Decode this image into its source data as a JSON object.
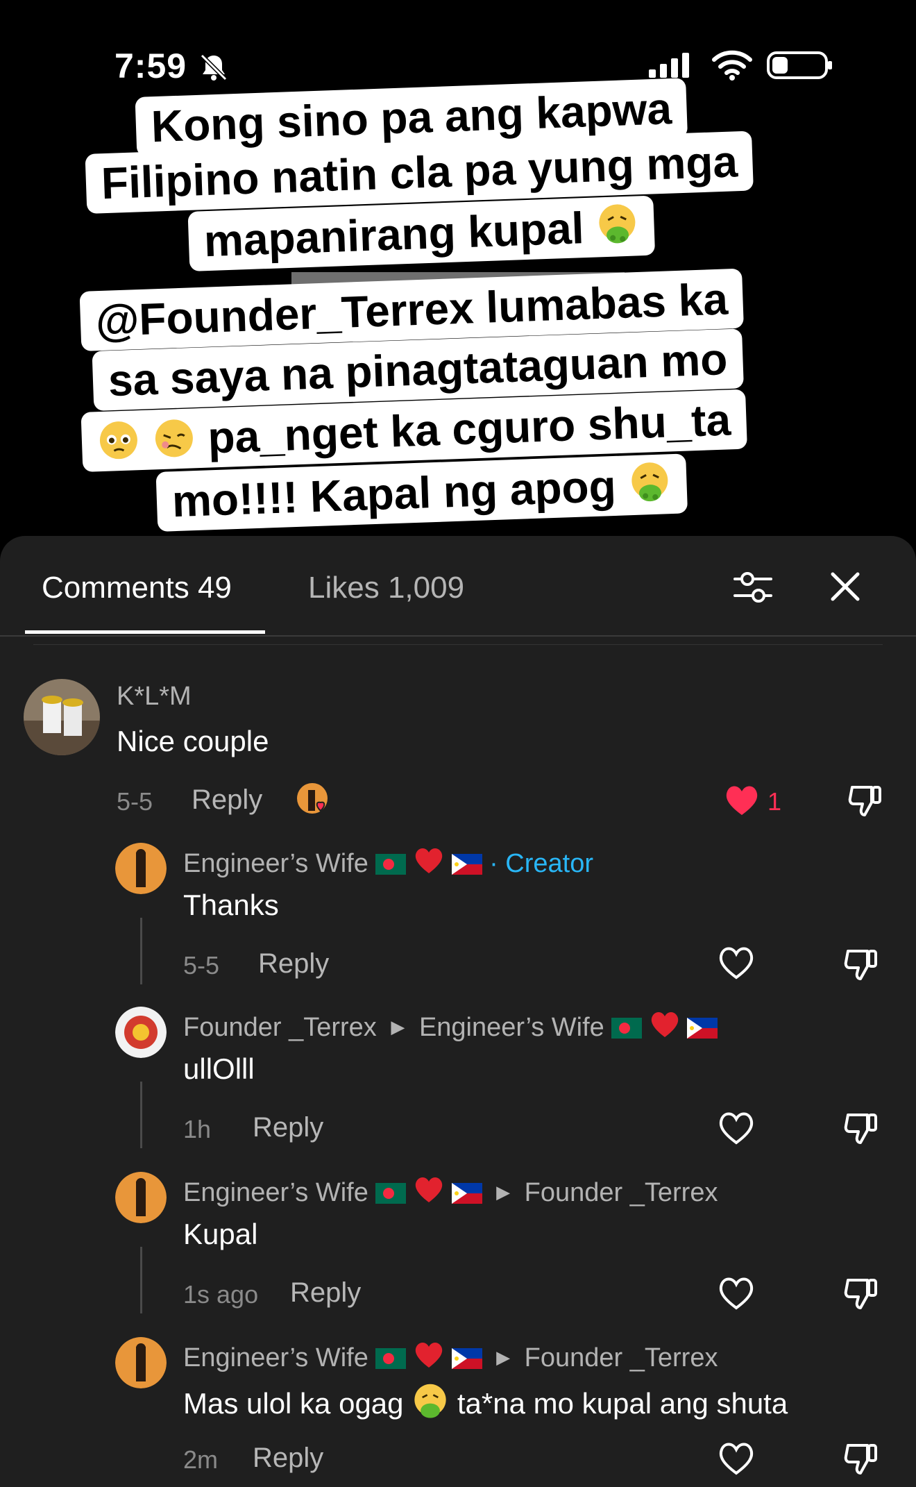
{
  "status_bar": {
    "time": "7:59"
  },
  "overlay": {
    "line1": "Kong sino pa ang kapwa",
    "line2": "Filipino natin cla pa yung mga",
    "line3": "mapanirang kupal",
    "line4": "@Founder_Terrex lumabas ka",
    "line5": "sa saya na pinagtataguan mo",
    "line6": "pa_nget ka cguro shu_ta",
    "line7": "mo!!!! Kapal ng apog"
  },
  "tabs": {
    "comments": "Comments 49",
    "likes": "Likes 1,009"
  },
  "comments": [
    {
      "name": "K*L*M",
      "text": "Nice couple",
      "time": "5-5",
      "reply": "Reply",
      "likes": "1"
    },
    {
      "name": "Engineer’s Wife",
      "badge": "· Creator",
      "text": "Thanks",
      "time": "5-5",
      "reply": "Reply"
    },
    {
      "name": "Founder _Terrex",
      "to": "Engineer’s Wife",
      "text": "ullOlll",
      "time": "1h",
      "reply": "Reply"
    },
    {
      "name": "Engineer’s Wife",
      "to": "Founder _Terrex",
      "text": "Kupal",
      "time": "1s ago",
      "reply": "Reply"
    },
    {
      "name": "Engineer’s Wife",
      "to": "Founder _Terrex",
      "text_a": "Mas ulol ka ogag",
      "text_b": "ta*na mo kupal ang shuta",
      "time": "2m",
      "reply": "Reply"
    }
  ],
  "colors": {
    "sheet": "#1f1f1f",
    "creator": "#29b6f6",
    "liked_heart": "#ff2f55"
  },
  "icons": [
    "bell-slash-icon",
    "signal-icon",
    "wifi-icon",
    "battery-icon",
    "filter-icon",
    "close-icon",
    "heart-icon",
    "dislike-icon",
    "nauseated-face-emoji",
    "flag-bangladesh",
    "flag-philippines"
  ]
}
